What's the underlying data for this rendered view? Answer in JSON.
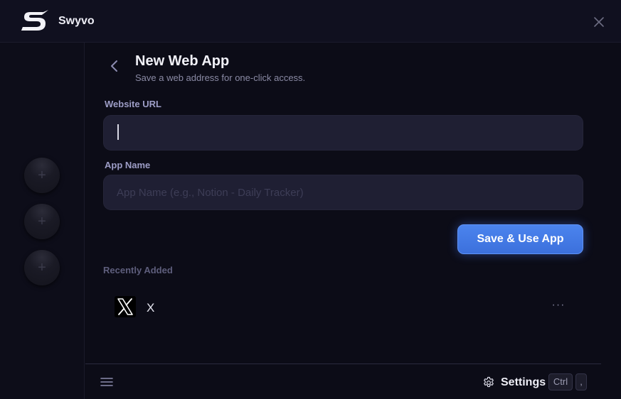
{
  "app": {
    "title": "Swyvo"
  },
  "sidebar": {
    "slots": [
      {
        "label": "+"
      },
      {
        "label": "+"
      },
      {
        "label": "+"
      }
    ]
  },
  "header": {
    "title": "New Web App",
    "subtitle": "Save a web address for one-click access."
  },
  "form": {
    "url_label": "Website URL",
    "url_value": "",
    "url_placeholder": "",
    "name_label": "App Name",
    "name_value": "",
    "name_placeholder": "App Name (e.g., Notion - Daily Tracker)",
    "save_label": "Save & Use App"
  },
  "recent": {
    "section_label": "Recently Added",
    "items": [
      {
        "label": "X",
        "icon": "x-logo-icon",
        "more_label": "···"
      }
    ]
  },
  "footer": {
    "settings_label": "Settings",
    "shortcut_keys": [
      "Ctrl",
      ","
    ]
  },
  "colors": {
    "accent": "#4279e6",
    "background": "#0c0c17",
    "input_bg": "#1f1f33",
    "label": "#9d9dc6"
  }
}
